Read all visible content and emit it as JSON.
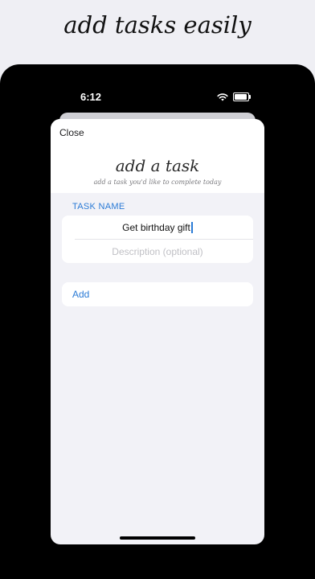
{
  "promo": {
    "headline": "add tasks easily"
  },
  "status_bar": {
    "time": "6:12",
    "icons": [
      "wifi-icon",
      "battery-icon"
    ]
  },
  "sheet": {
    "close_label": "Close",
    "title": "add a task",
    "subtitle": "add a task you'd like to complete today",
    "section_label": "TASK NAME",
    "task_name_value": "Get birthday gift",
    "description_placeholder": "Description (optional)",
    "add_label": "Add"
  },
  "colors": {
    "accent": "#2b7bd6",
    "background": "#efeff4",
    "phone_frame": "#000000",
    "sheet_background": "#f2f2f7"
  }
}
